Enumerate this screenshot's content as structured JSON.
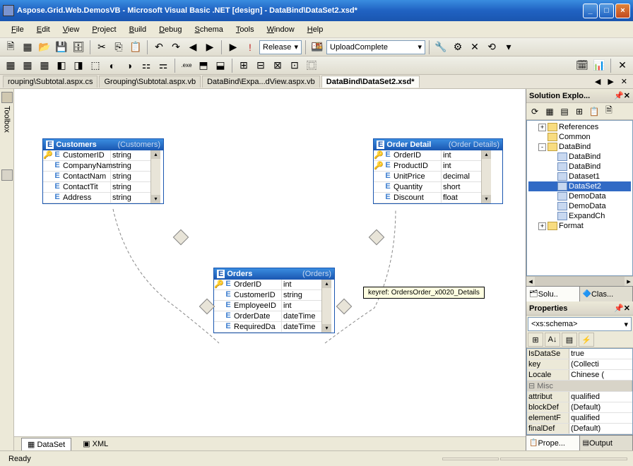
{
  "window": {
    "title": "Aspose.Grid.Web.DemosVB - Microsoft Visual Basic .NET [design] - DataBind\\DataSet2.xsd*"
  },
  "menu": [
    "File",
    "Edit",
    "View",
    "Project",
    "Build",
    "Debug",
    "Schema",
    "Tools",
    "Window",
    "Help"
  ],
  "menu_underline": [
    "F",
    "E",
    "V",
    "P",
    "B",
    "D",
    "S",
    "T",
    "W",
    "H"
  ],
  "toolbar1": {
    "config": "Release",
    "config_extra": "UploadComplete"
  },
  "tabs": {
    "items": [
      "rouping\\Subtotal.aspx.cs",
      "Grouping\\Subtotal.aspx.vb",
      "DataBind\\Expa...dView.aspx.vb",
      "DataBind\\DataSet2.xsd*"
    ],
    "active_index": 3
  },
  "toolbox_label": "Toolbox",
  "entities": {
    "customers": {
      "name": "Customers",
      "subtitle": "(Customers)",
      "fields": [
        {
          "key": true,
          "name": "CustomerID",
          "type": "string"
        },
        {
          "key": false,
          "name": "CompanyNam",
          "type": "string"
        },
        {
          "key": false,
          "name": "ContactNam",
          "type": "string"
        },
        {
          "key": false,
          "name": "ContactTit",
          "type": "string"
        },
        {
          "key": false,
          "name": "Address",
          "type": "string"
        }
      ]
    },
    "orders": {
      "name": "Orders",
      "subtitle": "(Orders)",
      "fields": [
        {
          "key": true,
          "name": "OrderID",
          "type": "int"
        },
        {
          "key": false,
          "name": "CustomerID",
          "type": "string"
        },
        {
          "key": false,
          "name": "EmployeeID",
          "type": "int"
        },
        {
          "key": false,
          "name": "OrderDate",
          "type": "dateTime"
        },
        {
          "key": false,
          "name": "RequiredDa",
          "type": "dateTime"
        }
      ]
    },
    "order_details": {
      "name": "Order Detail",
      "subtitle": "(Order Details)",
      "fields": [
        {
          "key": true,
          "name": "OrderID",
          "type": "int"
        },
        {
          "key": true,
          "name": "ProductID",
          "type": "int"
        },
        {
          "key": false,
          "name": "UnitPrice",
          "type": "decimal"
        },
        {
          "key": false,
          "name": "Quantity",
          "type": "short"
        },
        {
          "key": false,
          "name": "Discount",
          "type": "float"
        }
      ]
    }
  },
  "tooltip": "keyref: OrdersOrder_x0020_Details",
  "designer_tabs": {
    "dataset": "DataSet",
    "xml": "XML"
  },
  "solution": {
    "title": "Solution Explo...",
    "nodes": [
      {
        "depth": 1,
        "exp": "+",
        "icon": "folder",
        "label": "References"
      },
      {
        "depth": 1,
        "exp": "",
        "icon": "folder",
        "label": "Common"
      },
      {
        "depth": 1,
        "exp": "-",
        "icon": "folder",
        "label": "DataBind"
      },
      {
        "depth": 2,
        "exp": "",
        "icon": "file",
        "label": "DataBind"
      },
      {
        "depth": 2,
        "exp": "",
        "icon": "file",
        "label": "DataBind"
      },
      {
        "depth": 2,
        "exp": "",
        "icon": "file",
        "label": "Dataset1"
      },
      {
        "depth": 2,
        "exp": "",
        "icon": "file",
        "label": "DataSet2",
        "selected": true
      },
      {
        "depth": 2,
        "exp": "",
        "icon": "file",
        "label": "DemoData"
      },
      {
        "depth": 2,
        "exp": "",
        "icon": "file",
        "label": "DemoData"
      },
      {
        "depth": 2,
        "exp": "",
        "icon": "file",
        "label": "ExpandCh"
      },
      {
        "depth": 1,
        "exp": "+",
        "icon": "folder",
        "label": "Format"
      }
    ],
    "tabs": {
      "solu": "Solu..",
      "clas": "Clas..."
    }
  },
  "properties": {
    "title": "Properties",
    "selector": "<xs:schema>",
    "rows": [
      {
        "cat": false,
        "name": "IsDataSe",
        "value": "true"
      },
      {
        "cat": false,
        "name": "key",
        "value": "(Collecti"
      },
      {
        "cat": false,
        "name": "Locale",
        "value": "Chinese ("
      },
      {
        "cat": true,
        "name": "Misc",
        "value": ""
      },
      {
        "cat": false,
        "name": "attribut",
        "value": "qualified"
      },
      {
        "cat": false,
        "name": "blockDef",
        "value": "(Default)"
      },
      {
        "cat": false,
        "name": "elementF",
        "value": "qualified"
      },
      {
        "cat": false,
        "name": "finalDef",
        "value": "(Default)"
      }
    ],
    "tabs": {
      "prope": "Prope...",
      "output": "Output"
    }
  },
  "status": "Ready"
}
